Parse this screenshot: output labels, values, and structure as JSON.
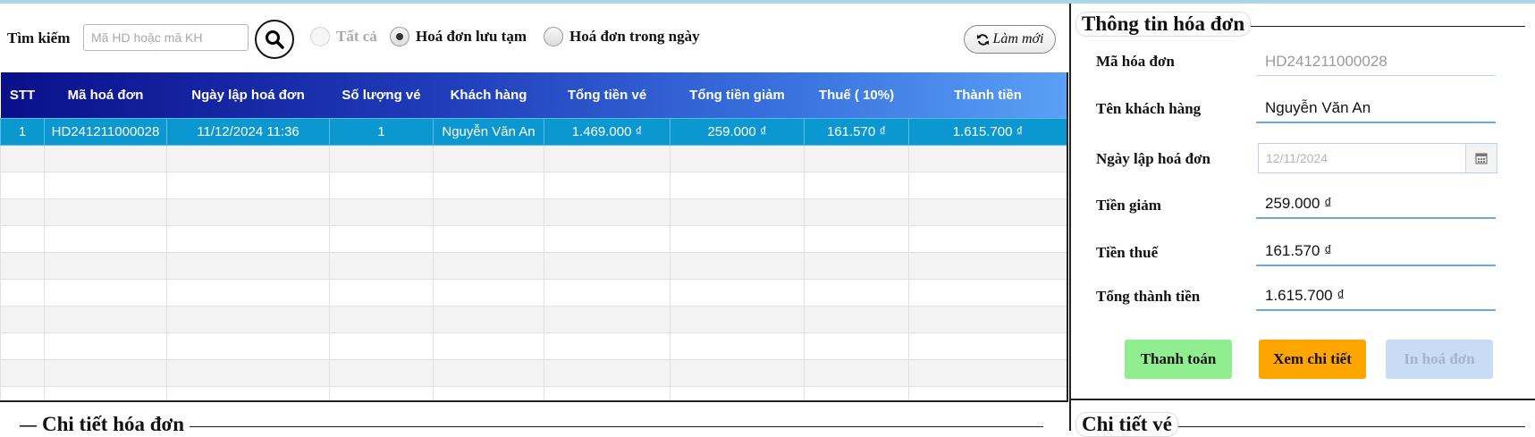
{
  "search": {
    "label": "Tìm kiếm",
    "placeholder": "Mã HD hoặc mã KH",
    "value": ""
  },
  "filters": [
    {
      "label": "Tất cả",
      "state": "disabled"
    },
    {
      "label": "Hoá đơn lưu tạm",
      "state": "checked"
    },
    {
      "label": "Hoá đơn trong ngày",
      "state": "unchecked"
    }
  ],
  "refresh_label": "Làm mới",
  "table": {
    "columns": [
      "STT",
      "Mã hoá đơn",
      "Ngày lập hoá đơn",
      "Số lượng vé",
      "Khách hàng",
      "Tổng tiền vé",
      "Tổng tiền giảm",
      "Thuế ( 10%)",
      "Thành tiền"
    ],
    "rows": [
      [
        "1",
        "HD241211000028",
        "11/12/2024 11:36",
        "1",
        "Nguyễn Văn An",
        "1.469.000 ₫",
        "259.000 ₫",
        "161.570 ₫",
        "1.615.700 ₫"
      ]
    ],
    "selected_row": 0
  },
  "invoice_info": {
    "title": "Thông tin hóa đơn",
    "ma_hoa_don": {
      "label": "Mã hóa đơn",
      "value": "HD241211000028"
    },
    "ten_khach_hang": {
      "label": "Tên khách hàng",
      "value": "Nguyễn Văn An"
    },
    "ngay_lap": {
      "label": "Ngày lập hoá đơn",
      "value": "12/11/2024"
    },
    "tien_giam": {
      "label": "Tiền giảm",
      "value": "259.000 ₫"
    },
    "tien_thue": {
      "label": "Tiền thuế",
      "value": "161.570 ₫"
    },
    "tong_thanh_tien": {
      "label": "Tổng thành tiền",
      "value": "1.615.700 ₫"
    }
  },
  "buttons": {
    "pay": {
      "label": "Thanh toán",
      "color": "#90ee90"
    },
    "detail": {
      "label": "Xem chi tiết",
      "color": "#ffa500"
    },
    "print": {
      "label": "In hoá đơn",
      "color": "#c9dcf5",
      "disabled": true
    }
  },
  "sections": {
    "invoice_detail": "Chi tiết hóa đơn",
    "ticket_detail": "Chi tiết vé"
  }
}
